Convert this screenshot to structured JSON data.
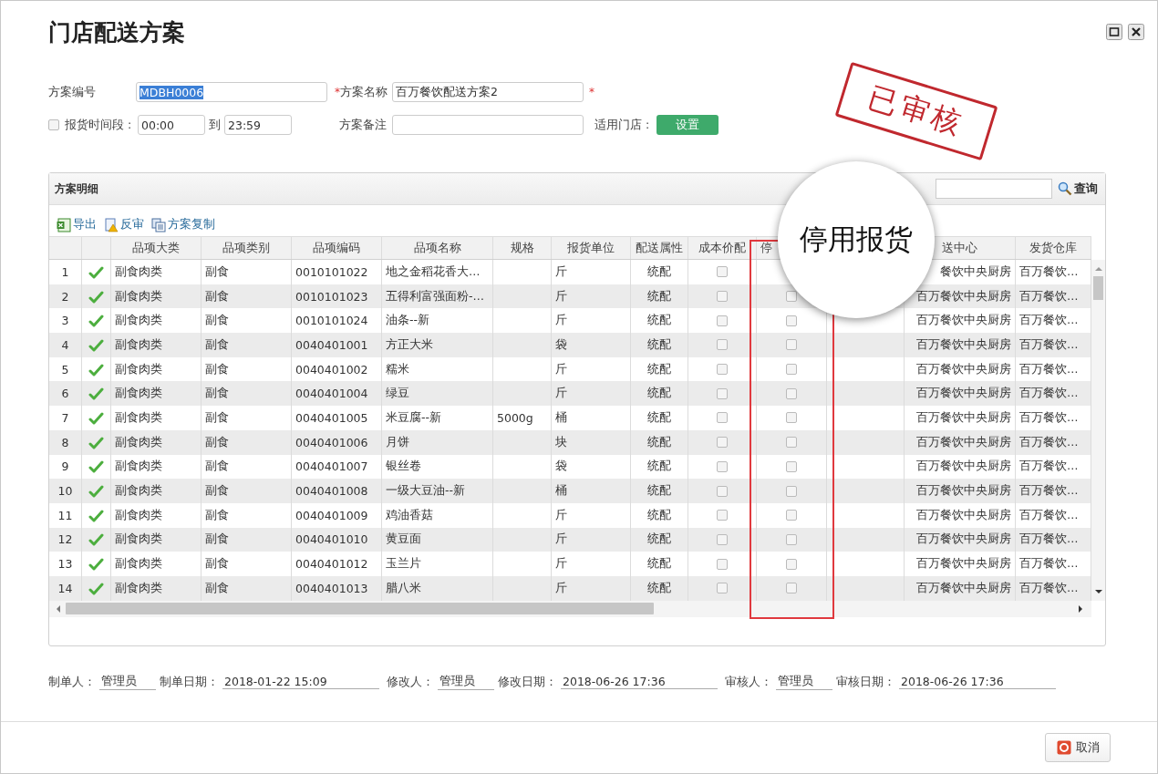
{
  "window": {
    "title": "门店配送方案"
  },
  "form": {
    "code": {
      "label": "方案编号",
      "value": "MDBH0006",
      "selected": true
    },
    "name": {
      "mark": "*",
      "label": "方案名称",
      "value": "百万餐饮配送方案2",
      "trailing_mark": "*"
    },
    "period": {
      "checked": false,
      "label": "报货时间段 :",
      "from": "00:00",
      "to_label": "到",
      "to": "23:59"
    },
    "remark": {
      "label": "方案备注"
    },
    "stores": {
      "label": "适用门店 :",
      "button": "设置"
    }
  },
  "stamp": {
    "text": "已审核"
  },
  "panel": {
    "title": "方案明细",
    "search_button": "查询",
    "toolbar": [
      {
        "kind": "export",
        "label": "导出"
      },
      {
        "kind": "unaudit",
        "label": "反审"
      },
      {
        "kind": "copy",
        "label": "方案复制"
      }
    ],
    "table": {
      "columns": [
        {
          "label": "品项大类"
        },
        {
          "label": "品项类别"
        },
        {
          "label": "品项编码"
        },
        {
          "label": "品项名称"
        },
        {
          "label": "规格"
        },
        {
          "label": "报货单位"
        },
        {
          "label": "配送属性"
        },
        {
          "label": "成本价配"
        },
        {
          "label": "停"
        },
        {
          "label": "送中心"
        },
        {
          "label": "发货仓库"
        }
      ],
      "rows": [
        {
          "no": "1",
          "approved": true,
          "category": "副食肉类",
          "type": "副食",
          "code": "0010101022",
          "name": "地之金稻花香大…",
          "unit": "斤",
          "mode": "统配",
          "cost_price": false,
          "center": "餐饮中央厨房",
          "warehouse": "百万餐饮…"
        },
        {
          "no": "2",
          "approved": true,
          "category": "副食肉类",
          "type": "副食",
          "code": "0010101023",
          "name": "五得利富强面粉-…",
          "unit": "斤",
          "mode": "统配",
          "cost_price": false,
          "stop": false,
          "center": "百万餐饮中央厨房",
          "warehouse": "百万餐饮…"
        },
        {
          "no": "3",
          "approved": true,
          "category": "副食肉类",
          "type": "副食",
          "code": "0010101024",
          "name": "油条--新",
          "unit": "斤",
          "mode": "统配",
          "cost_price": false,
          "stop": false,
          "center": "百万餐饮中央厨房",
          "warehouse": "百万餐饮…"
        },
        {
          "no": "4",
          "approved": true,
          "category": "副食肉类",
          "type": "副食",
          "code": "0040401001",
          "name": "方正大米",
          "unit": "袋",
          "mode": "统配",
          "cost_price": false,
          "stop": false,
          "center": "百万餐饮中央厨房",
          "warehouse": "百万餐饮…"
        },
        {
          "no": "5",
          "approved": true,
          "category": "副食肉类",
          "type": "副食",
          "code": "0040401002",
          "name": "糯米",
          "unit": "斤",
          "mode": "统配",
          "cost_price": false,
          "stop": false,
          "center": "百万餐饮中央厨房",
          "warehouse": "百万餐饮…"
        },
        {
          "no": "6",
          "approved": true,
          "category": "副食肉类",
          "type": "副食",
          "code": "0040401004",
          "name": "绿豆",
          "unit": "斤",
          "mode": "统配",
          "cost_price": false,
          "stop": false,
          "center": "百万餐饮中央厨房",
          "warehouse": "百万餐饮…"
        },
        {
          "no": "7",
          "approved": true,
          "category": "副食肉类",
          "type": "副食",
          "code": "0040401005",
          "name": "米豆腐--新",
          "spec": "5000g",
          "unit": "桶",
          "mode": "统配",
          "cost_price": false,
          "stop": false,
          "center": "百万餐饮中央厨房",
          "warehouse": "百万餐饮…"
        },
        {
          "no": "8",
          "approved": true,
          "category": "副食肉类",
          "type": "副食",
          "code": "0040401006",
          "name": "月饼",
          "unit": "块",
          "mode": "统配",
          "cost_price": false,
          "stop": false,
          "center": "百万餐饮中央厨房",
          "warehouse": "百万餐饮…"
        },
        {
          "no": "9",
          "approved": true,
          "category": "副食肉类",
          "type": "副食",
          "code": "0040401007",
          "name": "银丝卷",
          "unit": "袋",
          "mode": "统配",
          "cost_price": false,
          "stop": false,
          "center": "百万餐饮中央厨房",
          "warehouse": "百万餐饮…"
        },
        {
          "no": "10",
          "approved": true,
          "category": "副食肉类",
          "type": "副食",
          "code": "0040401008",
          "name": "一级大豆油--新",
          "unit": "桶",
          "mode": "统配",
          "cost_price": false,
          "stop": false,
          "center": "百万餐饮中央厨房",
          "warehouse": "百万餐饮…"
        },
        {
          "no": "11",
          "approved": true,
          "category": "副食肉类",
          "type": "副食",
          "code": "0040401009",
          "name": "鸡油香菇",
          "unit": "斤",
          "mode": "统配",
          "cost_price": false,
          "stop": false,
          "center": "百万餐饮中央厨房",
          "warehouse": "百万餐饮…"
        },
        {
          "no": "12",
          "approved": true,
          "category": "副食肉类",
          "type": "副食",
          "code": "0040401010",
          "name": "黄豆面",
          "unit": "斤",
          "mode": "统配",
          "cost_price": false,
          "stop": false,
          "center": "百万餐饮中央厨房",
          "warehouse": "百万餐饮…"
        },
        {
          "no": "13",
          "approved": true,
          "category": "副食肉类",
          "type": "副食",
          "code": "0040401012",
          "name": "玉兰片",
          "unit": "斤",
          "mode": "统配",
          "cost_price": false,
          "stop": false,
          "center": "百万餐饮中央厨房",
          "warehouse": "百万餐饮…"
        },
        {
          "no": "14",
          "approved": true,
          "category": "副食肉类",
          "type": "副食",
          "code": "0040401013",
          "name": "腊八米",
          "unit": "斤",
          "mode": "统配",
          "cost_price": false,
          "stop": false,
          "center": "百万餐饮中央厨房",
          "warehouse": "百万餐饮…"
        }
      ]
    }
  },
  "magnifier": {
    "text": "停用报货"
  },
  "footer_info": [
    {
      "label": "制单人：",
      "value": "管理员",
      "kind": "short"
    },
    {
      "label": "制单日期：",
      "value": "2018-01-22 15:09",
      "kind": "long"
    },
    {
      "label": "修改人：",
      "value": "管理员",
      "kind": "short"
    },
    {
      "label": "修改日期：",
      "value": "2018-06-26 17:36",
      "kind": "long"
    },
    {
      "label": "审核人：",
      "value": "管理员",
      "kind": "short"
    },
    {
      "label": "审核日期：",
      "value": "2018-06-26 17:36",
      "kind": "long"
    }
  ],
  "buttons": [
    {
      "label": "取消"
    }
  ]
}
